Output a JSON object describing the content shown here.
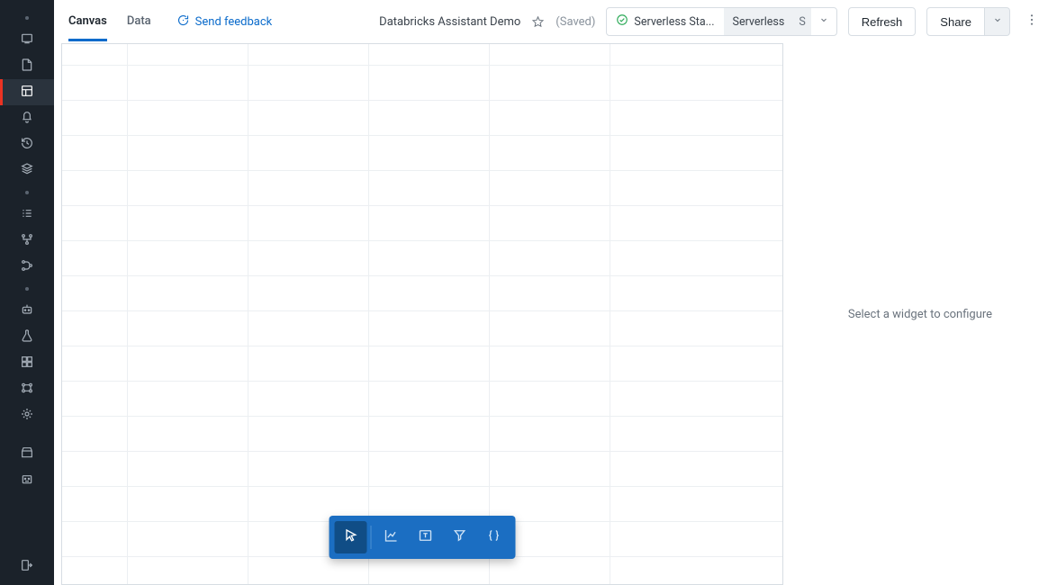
{
  "sidebar": {
    "group1": [
      {
        "name": "workspace-icon"
      },
      {
        "name": "repo-icon"
      },
      {
        "name": "dashboard-icon",
        "active": true
      },
      {
        "name": "alerts-icon"
      },
      {
        "name": "history-icon"
      },
      {
        "name": "catalog-icon"
      }
    ],
    "group2": [
      {
        "name": "tasks-icon"
      },
      {
        "name": "workflows-icon"
      },
      {
        "name": "pipelines-icon"
      }
    ],
    "group3": [
      {
        "name": "robot-icon"
      },
      {
        "name": "experiment-icon"
      },
      {
        "name": "models-icon"
      },
      {
        "name": "features-icon"
      },
      {
        "name": "serving-icon"
      }
    ],
    "group4": [
      {
        "name": "marketplace-icon"
      },
      {
        "name": "partner-icon"
      }
    ],
    "bottom": [
      {
        "name": "logout-icon"
      }
    ]
  },
  "tabs": [
    {
      "label": "Canvas",
      "active": true
    },
    {
      "label": "Data",
      "active": false
    }
  ],
  "feedback_label": "Send feedback",
  "page_title": "Databricks Assistant Demo",
  "saved_label": "(Saved)",
  "cluster": {
    "status_icon": "check-circle-icon",
    "status_label": "Serverless Sta...",
    "runtime_label": "Serverless",
    "badge": "S"
  },
  "buttons": {
    "refresh": "Refresh",
    "share": "Share"
  },
  "toolbar": {
    "tools": [
      {
        "name": "cursor-tool-icon",
        "active": true
      },
      {
        "name": "chart-tool-icon",
        "active": false
      },
      {
        "name": "text-tool-icon",
        "active": false
      },
      {
        "name": "filter-tool-icon",
        "active": false
      },
      {
        "name": "param-tool-icon",
        "active": false
      }
    ]
  },
  "config_placeholder": "Select a widget to configure"
}
